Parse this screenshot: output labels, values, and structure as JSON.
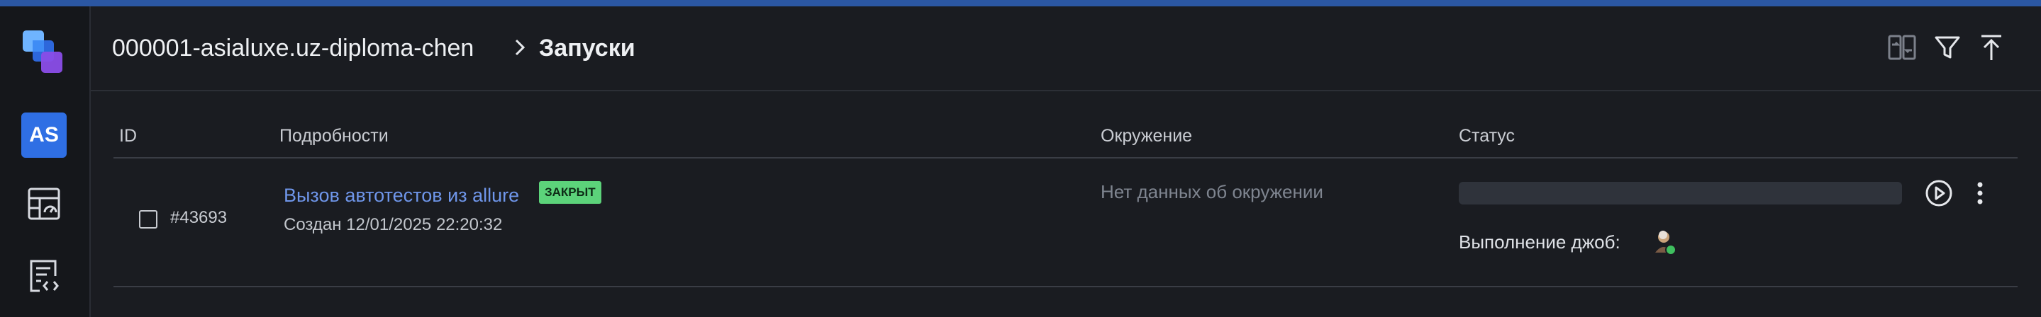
{
  "sidebar": {
    "avatar_initials": "AS",
    "nav_icons": [
      "dashboard-icon",
      "code-file-icon"
    ]
  },
  "header": {
    "project": "000001-asialuxe.uz-diploma-chen",
    "current": "Запуски",
    "actions": [
      "compare-icon",
      "filter-icon",
      "upload-icon"
    ]
  },
  "table": {
    "columns": {
      "id": "ID",
      "details": "Подробности",
      "environment": "Окружение",
      "status": "Статус"
    },
    "rows": [
      {
        "id": "#43693",
        "title": "Вызов автотестов из allure",
        "badge": "ЗАКРЫТ",
        "created": "Создан 12/01/2025 22:20:32",
        "environment": "Нет данных об окружении",
        "jobs_label": "Выполнение джоб:"
      }
    ]
  },
  "colors": {
    "background": "#1a1c21",
    "sidebar": "#15171b",
    "accent": "#2f6fe4",
    "link": "#6f96ea",
    "badge": "#5cd37a",
    "top_bar": "#2b57a3"
  }
}
